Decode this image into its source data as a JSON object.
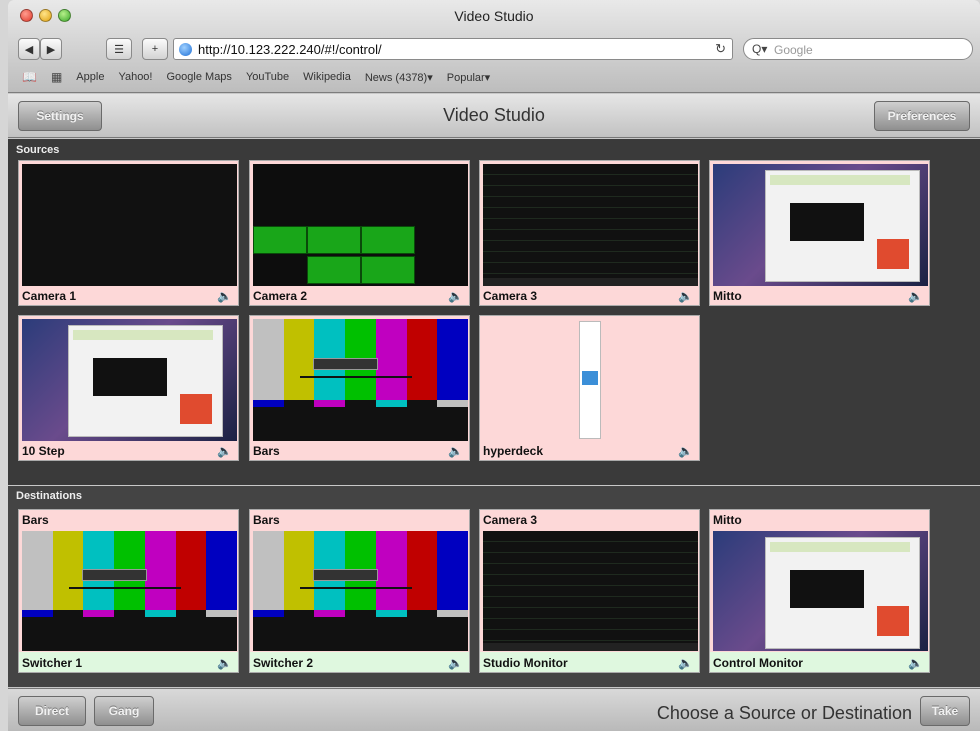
{
  "browser": {
    "window_title": "Video Studio",
    "url": "http://10.123.222.240/#!/control/",
    "search_placeholder": "Google",
    "bookmarks": [
      "Apple",
      "Yahoo!",
      "Google Maps",
      "YouTube",
      "Wikipedia",
      "News (4378)▾",
      "Popular▾"
    ]
  },
  "app": {
    "title": "Video Studio",
    "settings_label": "Settings",
    "preferences_label": "Preferences"
  },
  "sources": {
    "heading": "Sources",
    "items": [
      {
        "label": "Camera 1"
      },
      {
        "label": "Camera 2"
      },
      {
        "label": "Camera 3"
      },
      {
        "label": "Mitto"
      },
      {
        "label": "10 Step"
      },
      {
        "label": "Bars"
      },
      {
        "label": "hyperdeck"
      }
    ]
  },
  "destinations": {
    "heading": "Destinations",
    "items": [
      {
        "source": "Bars",
        "name": "Switcher 1"
      },
      {
        "source": "Bars",
        "name": "Switcher 2"
      },
      {
        "source": "Camera 3",
        "name": "Studio Monitor"
      },
      {
        "source": "Mitto",
        "name": "Control Monitor"
      }
    ]
  },
  "footer": {
    "direct_label": "Direct",
    "gang_label": "Gang",
    "hint": "Choose a Source or Destination",
    "take_label": "Take"
  },
  "icons": {
    "speaker": "speaker-icon"
  },
  "colors": {
    "tile_bg": "#fdd8d8",
    "dest_bottom_bg": "#dff8df",
    "panel_bg": "#3a3a3a"
  }
}
